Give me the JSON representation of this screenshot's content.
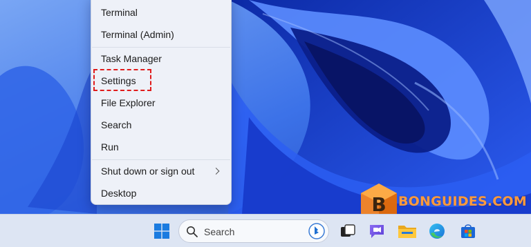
{
  "menu": {
    "items": [
      {
        "label": "Terminal"
      },
      {
        "label": "Terminal (Admin)"
      },
      {
        "label": "Task Manager"
      },
      {
        "label": "Settings"
      },
      {
        "label": "File Explorer"
      },
      {
        "label": "Search"
      },
      {
        "label": "Run"
      },
      {
        "label": "Shut down or sign out",
        "submenu_icon": "chevron-right-icon"
      },
      {
        "label": "Desktop"
      }
    ],
    "highlighted_item": "Settings",
    "highlight_color": "#e01b1b"
  },
  "taskbar": {
    "start_icon": "windows-logo-icon",
    "search": {
      "placeholder": "Search",
      "icon": "search-icon",
      "bing_icon": "bing-icon"
    },
    "pinned_icons": [
      "task-view-icon",
      "chat-icon",
      "file-explorer-icon",
      "edge-icon",
      "store-icon"
    ]
  },
  "watermark": {
    "text": "BONGUIDES.COM",
    "logo_letter": "B",
    "color": "#ff9a3c"
  },
  "colors": {
    "accent": "#1c5ad6",
    "menu_bg": "#eef1f8",
    "taskbar_bg": "#dde5f3"
  }
}
